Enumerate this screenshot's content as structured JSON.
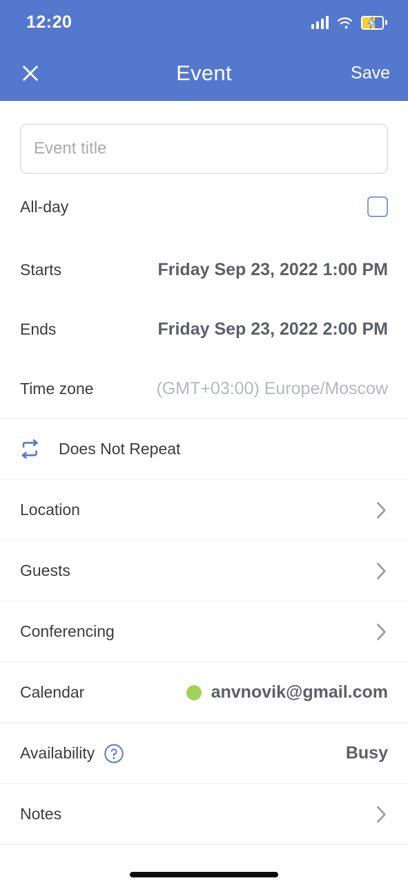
{
  "status_bar": {
    "time": "12:20",
    "signal_icon": "signal-bars-icon",
    "wifi_icon": "wifi-icon",
    "battery_icon": "battery-charging-icon"
  },
  "header": {
    "close_icon": "close-icon",
    "title": "Event",
    "save_label": "Save",
    "background_color": "#5478CE"
  },
  "form": {
    "title_field": {
      "value": "",
      "placeholder": "Event title"
    },
    "all_day": {
      "label": "All-day",
      "checked": false
    },
    "starts": {
      "label": "Starts",
      "value": "Friday Sep 23, 2022 1:00 PM"
    },
    "ends": {
      "label": "Ends",
      "value": "Friday Sep 23, 2022 2:00 PM"
    },
    "time_zone": {
      "label": "Time zone",
      "value": "(GMT+03:00) Europe/Moscow"
    },
    "repeat": {
      "icon": "repeat-icon",
      "label": "Does Not Repeat"
    },
    "location": {
      "label": "Location",
      "chevron_icon": "chevron-right-icon"
    },
    "guests": {
      "label": "Guests",
      "chevron_icon": "chevron-right-icon"
    },
    "conferencing": {
      "label": "Conferencing",
      "chevron_icon": "chevron-right-icon"
    },
    "calendar": {
      "label": "Calendar",
      "value": "anvnovik@gmail.com",
      "dot_color": "#A0D255"
    },
    "availability": {
      "label": "Availability",
      "help_icon": "help-circle-icon",
      "value": "Busy"
    },
    "notes": {
      "label": "Notes",
      "chevron_icon": "chevron-right-icon"
    }
  },
  "system": {
    "home_indicator": "home-indicator"
  }
}
